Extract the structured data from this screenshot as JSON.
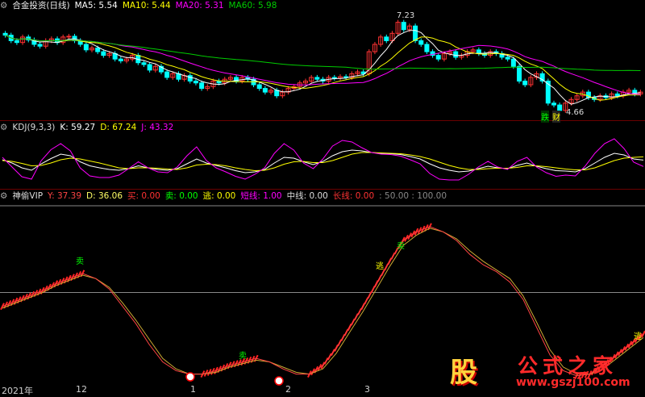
{
  "colors": {
    "bg": "#000000",
    "up": "#ff3333",
    "down": "#00ffff",
    "ma5": "#ffffff",
    "ma10": "#ffff00",
    "ma20": "#ff00ff",
    "ma60": "#00cc00",
    "sep": "#6a0000"
  },
  "legend_main": {
    "icon": "gear-icon",
    "title": "合金投资(日线)",
    "ma5": "MA5: 5.54",
    "ma10": "MA10: 5.44",
    "ma20": "MA20: 5.31",
    "ma60": "MA60: 5.98"
  },
  "legend_kdj": {
    "icon": "gear-icon",
    "title": "KDJ(9,3,3)",
    "k": "K: 59.27",
    "d": "D: 67.24",
    "j": "J: 43.32"
  },
  "legend_vip": {
    "icon": "gear-icon",
    "title": "神偷VIP",
    "y": "Y: 37.39",
    "d": "D: 36.06",
    "buy": "买: 0.00",
    "sell": "卖: 0.00",
    "escape": "逃: 0.00",
    "short": "短线: 1.00",
    "mid": "中线: 0.00",
    "long": "长线: 0.00",
    "levels": ": 50.00 : 100.00"
  },
  "annotations": {
    "high": "7.23",
    "low": "4.66",
    "sell_label": "卖",
    "escape_label": "逃",
    "fall_badge": "跌",
    "wealth_badge": "财"
  },
  "watermark": {
    "logo": "股",
    "title": "公式之家",
    "url": "www.gszj100.com"
  },
  "chart_data": [
    {
      "type": "candlestick",
      "title": "合金投资(日线)",
      "x_labels": [
        "2021年",
        "12",
        "1",
        "2",
        "3"
      ],
      "y_range": [
        4.5,
        7.4
      ],
      "close": [
        6.75,
        6.6,
        6.55,
        6.7,
        6.62,
        6.5,
        6.45,
        6.6,
        6.65,
        6.55,
        6.7,
        6.72,
        6.6,
        6.5,
        6.35,
        6.4,
        6.3,
        6.2,
        6.25,
        6.1,
        6.05,
        6.1,
        6.2,
        6.0,
        5.95,
        5.8,
        5.9,
        5.75,
        5.6,
        5.7,
        5.55,
        5.65,
        5.5,
        5.45,
        5.3,
        5.35,
        5.5,
        5.45,
        5.55,
        5.6,
        5.5,
        5.6,
        5.55,
        5.4,
        5.3,
        5.2,
        5.25,
        5.1,
        5.2,
        5.3,
        5.35,
        5.45,
        5.5,
        5.6,
        5.55,
        5.5,
        5.6,
        5.58,
        5.62,
        5.6,
        5.7,
        5.75,
        5.7,
        6.3,
        6.5,
        6.7,
        6.6,
        6.8,
        7.1,
        6.9,
        7.0,
        6.6,
        6.5,
        6.3,
        6.2,
        6.1,
        6.25,
        6.3,
        6.15,
        6.2,
        6.3,
        6.35,
        6.25,
        6.2,
        6.3,
        6.25,
        6.15,
        6.1,
        5.9,
        5.5,
        5.4,
        5.6,
        5.7,
        5.5,
        4.9,
        4.85,
        4.7,
        4.9,
        5.0,
        5.1,
        5.2,
        5.05,
        5.0,
        5.1,
        5.05,
        5.15,
        5.1,
        5.2,
        5.25,
        5.15,
        5.2
      ],
      "high": "7.23",
      "low": "4.66",
      "series": [
        {
          "name": "MA5",
          "values": [
            5.54
          ]
        },
        {
          "name": "MA10",
          "values": [
            5.44
          ]
        },
        {
          "name": "MA20",
          "values": [
            5.31
          ]
        },
        {
          "name": "MA60",
          "values": [
            5.98
          ]
        }
      ]
    },
    {
      "type": "line",
      "title": "KDJ(9,3,3)",
      "series": [
        {
          "name": "K",
          "last": 59.27,
          "values": [
            60,
            52,
            40,
            34,
            50,
            63,
            74,
            70,
            55,
            45,
            40,
            36,
            34,
            38,
            45,
            40,
            36,
            34,
            38,
            50,
            62,
            52,
            46,
            40,
            33,
            28,
            30,
            36,
            52,
            66,
            64,
            55,
            48,
            56,
            70,
            80,
            84,
            82,
            78,
            76,
            75,
            73,
            68,
            62,
            50,
            40,
            34,
            30,
            32,
            38,
            44,
            40,
            38,
            46,
            52,
            44,
            38,
            33,
            32,
            30,
            38,
            52,
            66,
            76,
            72,
            62,
            59.27
          ]
        },
        {
          "name": "D",
          "last": 67.24,
          "values": [
            58,
            56,
            51,
            45,
            46,
            52,
            60,
            64,
            62,
            57,
            52,
            46,
            40,
            38,
            40,
            40,
            39,
            37,
            36,
            40,
            47,
            49,
            48,
            45,
            40,
            36,
            33,
            34,
            40,
            49,
            55,
            56,
            53,
            53,
            58,
            66,
            74,
            78,
            78,
            77,
            76,
            75,
            72,
            68,
            62,
            54,
            46,
            40,
            36,
            36,
            38,
            39,
            39,
            41,
            45,
            45,
            43,
            40,
            37,
            35,
            35,
            40,
            49,
            58,
            64,
            66,
            67.24
          ]
        },
        {
          "name": "J",
          "last": 43.32,
          "values": [
            66,
            42,
            18,
            12,
            58,
            85,
            100,
            82,
            40,
            20,
            16,
            16,
            22,
            38,
            55,
            40,
            30,
            28,
            42,
            70,
            92,
            58,
            40,
            30,
            19,
            12,
            24,
            40,
            76,
            100,
            84,
            52,
            38,
            62,
            94,
            108,
            104,
            90,
            78,
            74,
            73,
            69,
            60,
            50,
            26,
            12,
            10,
            10,
            24,
            42,
            56,
            42,
            36,
            56,
            66,
            42,
            28,
            19,
            22,
            20,
            44,
            76,
            100,
            112,
            88,
            54,
            43.32
          ]
        }
      ]
    },
    {
      "type": "line",
      "title": "神偷VIP",
      "y_range": [
        0,
        100
      ],
      "levels": [
        50,
        100
      ],
      "series": [
        {
          "name": "Y",
          "last": 37.39,
          "values": [
            42,
            45,
            48,
            51,
            55,
            58,
            61,
            58,
            52,
            42,
            32,
            20,
            10,
            5,
            3,
            3,
            5,
            8,
            10,
            12,
            10,
            6,
            3,
            3,
            8,
            18,
            30,
            42,
            55,
            68,
            80,
            85,
            88,
            85,
            80,
            72,
            66,
            62,
            56,
            46,
            30,
            14,
            5,
            2,
            3,
            8,
            14,
            20,
            26
          ]
        },
        {
          "name": "D",
          "last": 36.06,
          "values": [
            41,
            44,
            47,
            50,
            54,
            57,
            60,
            58,
            53,
            44,
            34,
            23,
            12,
            6,
            3,
            3,
            4,
            7,
            9,
            11,
            10,
            7,
            4,
            3,
            6,
            15,
            27,
            39,
            52,
            65,
            77,
            83,
            87,
            85,
            81,
            74,
            68,
            63,
            58,
            48,
            33,
            17,
            7,
            3,
            3,
            6,
            12,
            18,
            24
          ]
        }
      ]
    }
  ]
}
